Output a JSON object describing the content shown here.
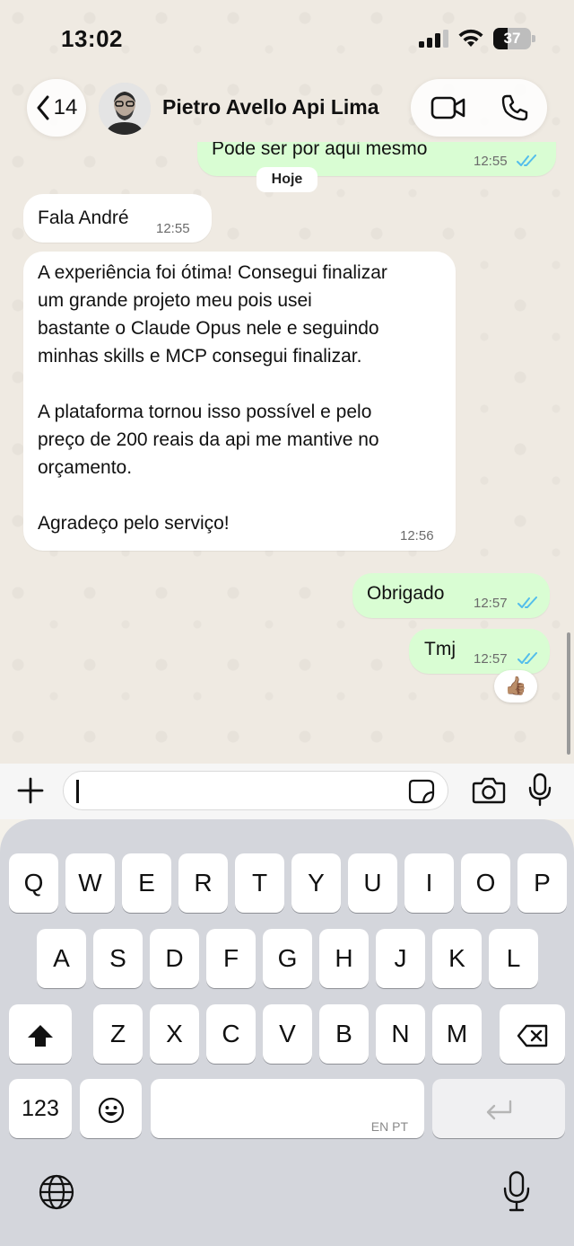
{
  "status_bar": {
    "time": "13:02",
    "battery_level": "37",
    "icons": [
      "signal-icon",
      "wifi-icon",
      "battery-icon"
    ]
  },
  "header": {
    "back_count": "14",
    "contact_name": "Pietro Avello Api Lima",
    "icons": [
      "chevron-left-icon",
      "video-call-icon",
      "phone-call-icon"
    ]
  },
  "chat": {
    "date_separator": "Hoje",
    "messages": [
      {
        "direction": "out",
        "text": "Pode ser por aqui mesmo",
        "time": "12:55",
        "status": "read"
      },
      {
        "direction": "in",
        "text": "Fala André",
        "time": "12:55"
      },
      {
        "direction": "in",
        "text": "A experiência foi ótima! Consegui finalizar\num grande projeto meu pois usei\nbastante o Claude Opus nele e seguindo\nminhas skills e MCP consegui finalizar.\n\nA plataforma tornou isso possível e pelo\npreço de 200 reais da api me mantive no\norçamento.\n\nAgradeço pelo serviço!",
        "time": "12:56"
      },
      {
        "direction": "out",
        "text": "Obrigado",
        "time": "12:57",
        "status": "read"
      },
      {
        "direction": "out",
        "text": "Tmj",
        "time": "12:57",
        "status": "read"
      }
    ],
    "reaction": "👍🏽",
    "read_tick_color": "#53bdeb"
  },
  "input_bar": {
    "message_value": "",
    "icons": [
      "plus-icon",
      "sticker-icon",
      "camera-icon",
      "microphone-icon"
    ]
  },
  "keyboard": {
    "row1": [
      "Q",
      "W",
      "E",
      "R",
      "T",
      "Y",
      "U",
      "I",
      "O",
      "P"
    ],
    "row2": [
      "A",
      "S",
      "D",
      "F",
      "G",
      "H",
      "J",
      "K",
      "L"
    ],
    "row3": [
      "Z",
      "X",
      "C",
      "V",
      "B",
      "N",
      "M"
    ],
    "numbers_key": "123",
    "space_languages": "EN PT",
    "icons": [
      "shift-icon",
      "backspace-icon",
      "emoji-icon",
      "return-icon",
      "globe-icon",
      "dictation-icon"
    ]
  }
}
